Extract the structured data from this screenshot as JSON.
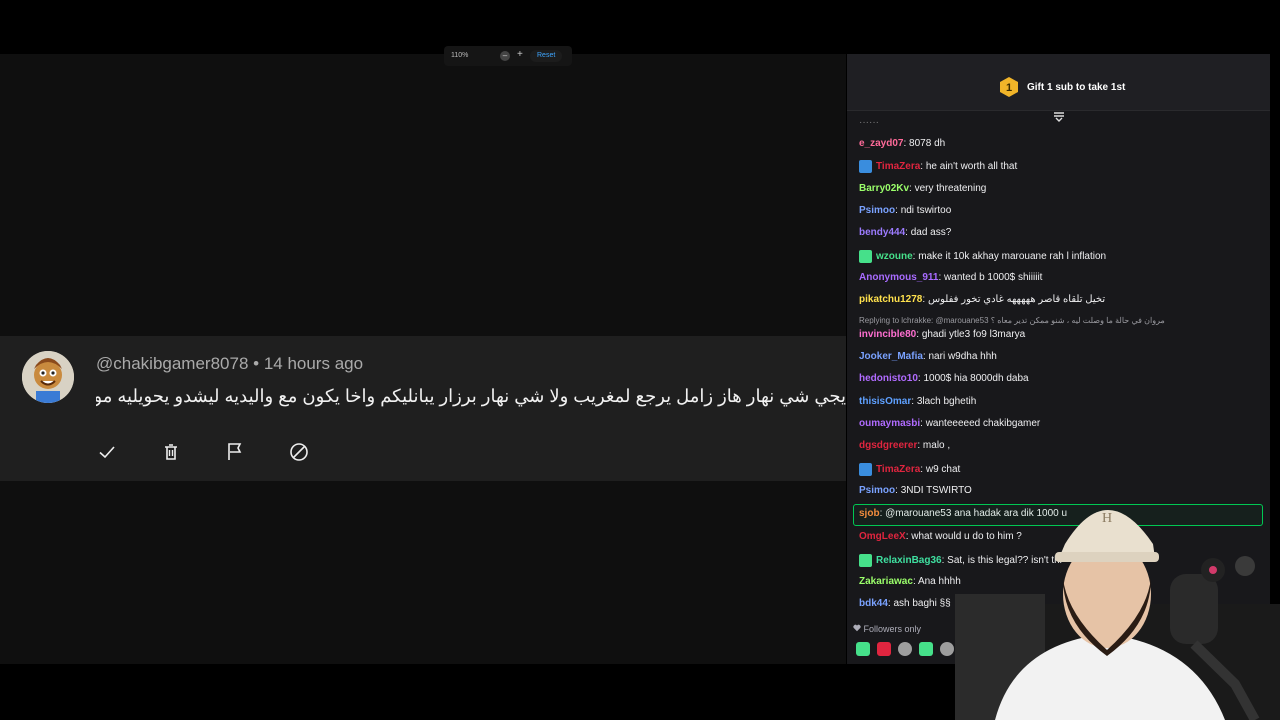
{
  "zoom": {
    "level": "110%",
    "minus": "–",
    "plus": "+",
    "reset_label": "Reset"
  },
  "comment": {
    "handle": "@chakibgamer8078",
    "separator": " • ",
    "time": "14 hours ago",
    "text": "يجي شي نهار هاز زامل يرجع لمغريب ولا شي نهار برزار يبانليكم واخا يكون مع واليديه ليشدو يحويليه مو",
    "actions": [
      "approve-icon",
      "delete-icon",
      "flag-icon",
      "block-icon"
    ]
  },
  "chat": {
    "pinned_label": "Gift 1 sub to take 1st",
    "pinned_rank": "1",
    "messages": [
      {
        "user": "e_zayd07",
        "sep": ": ",
        "text": "8078 dh",
        "color": "#ff6b9a",
        "badge": ""
      },
      {
        "user": "TimaZera",
        "sep": ": ",
        "text": "he ain't worth all that",
        "color": "#e0253f",
        "badge": "lightning"
      },
      {
        "user": "Barry02Kv",
        "sep": ": ",
        "text": "very threatening",
        "color": "#9bff6b",
        "badge": ""
      },
      {
        "user": "Psimoo",
        "sep": ": ",
        "text": "ndi tswirtoo",
        "color": "#7aa2ff",
        "badge": ""
      },
      {
        "user": "bendy444",
        "sep": ": ",
        "text": "dad ass?",
        "color": "#9c7bff",
        "badge": ""
      },
      {
        "user": "wzoune",
        "sep": ": ",
        "text": "make it 10k akhay marouane rah l inflation",
        "color": "#46e08a",
        "badge": "gift"
      },
      {
        "user": "Anonymous_911",
        "sep": ": ",
        "text": "wanted b 1000$ shiiiiit",
        "color": "#a86bff",
        "badge": ""
      },
      {
        "user": "pikatchu1278",
        "sep": ": ",
        "text": "تخيل تلقاه قاصر هههههه غادي تخور ففلوس",
        "color": "#ffe14d",
        "badge": ""
      },
      {
        "user": "invincible80",
        "sep": ": ",
        "text": "ghadi ytle3 fo9 l3marya",
        "color": "#ff6fd1",
        "badge": ""
      },
      {
        "user": "Jooker_Mafia",
        "sep": ": ",
        "text": "nari w9dha hhh",
        "color": "#7aa2ff",
        "badge": ""
      },
      {
        "user": "hedonisto10",
        "sep": ": ",
        "text": "1000$ hia 8000dh daba",
        "color": "#b06bff",
        "badge": ""
      },
      {
        "user": "thisisOmar",
        "sep": ": ",
        "text": "3lach bghetih",
        "color": "#5ea0ff",
        "badge": ""
      },
      {
        "user": "oumaymasbi",
        "sep": ": ",
        "text": "wanteeeeed chakibgamer",
        "color": "#b06bff",
        "badge": ""
      },
      {
        "user": "dgsdgreerer",
        "sep": ": ",
        "text": "malo ,",
        "color": "#e0253f",
        "badge": ""
      },
      {
        "user": "TimaZera",
        "sep": ": ",
        "text": "w9 chat",
        "color": "#e0253f",
        "badge": "lightning"
      },
      {
        "user": "Psimoo",
        "sep": ": ",
        "text": "3NDI TSWIRTO",
        "color": "#7aa2ff",
        "badge": ""
      },
      {
        "user": "sjob",
        "sep": ": ",
        "text": "@marouane53 ana hadak ara dik 1000 u",
        "color": "#ff8a3d",
        "badge": ""
      },
      {
        "user": "OmgLeeX",
        "sep": ": ",
        "text": "what would u do to him ?",
        "color": "#e0253f",
        "badge": ""
      },
      {
        "user": "RelaxinBag36",
        "sep": ": ",
        "text": "Sat, is this legal?? isn't thi",
        "color": "#3fe0a0",
        "badge": "gift"
      },
      {
        "user": "Zakariawac",
        "sep": ": ",
        "text": "Ana hhhh",
        "color": "#9bff6b",
        "badge": ""
      },
      {
        "user": "bdk44",
        "sep": ": ",
        "text": "ash baghi §§",
        "color": "#7aa2ff",
        "badge": ""
      }
    ],
    "reply_context": "Replying to lchrakke: @marouane53 مروان في حالة ما وصلت ليه ، شنو ممكن تدير معاه ؟",
    "followers_only": "Followers only"
  }
}
